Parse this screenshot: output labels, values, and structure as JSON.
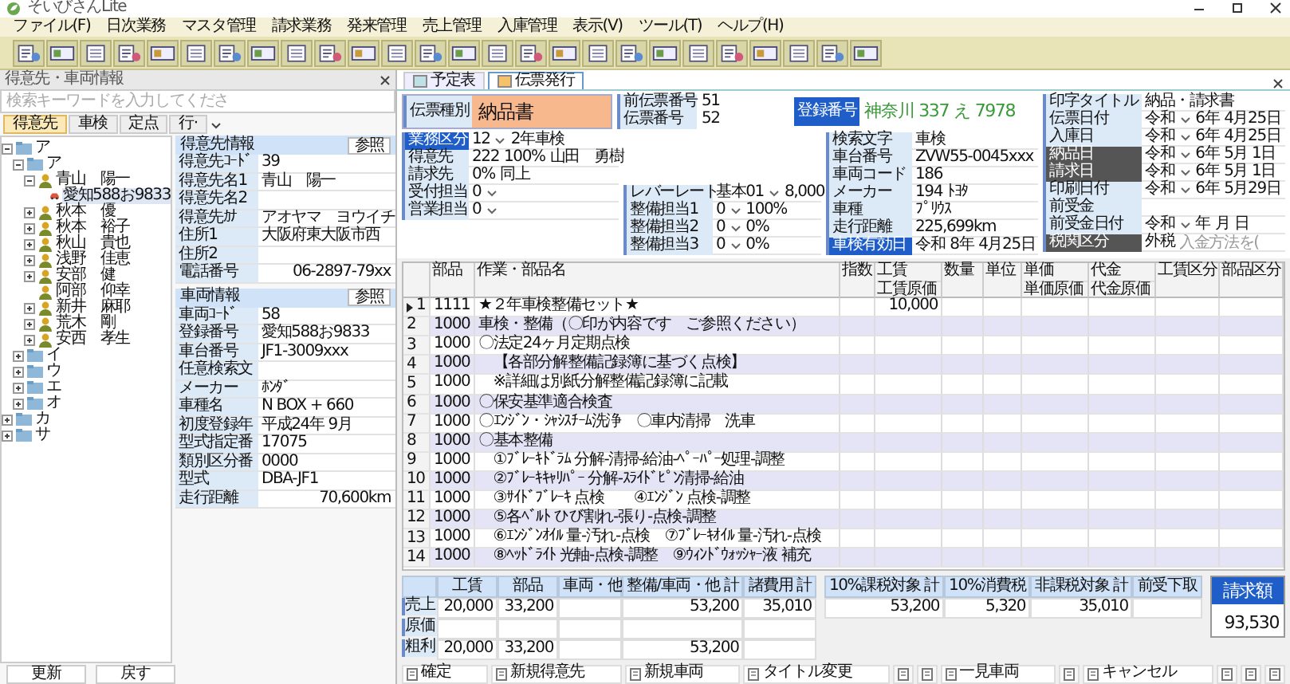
{
  "window": {
    "title": "そいびさんLite"
  },
  "menu": [
    "ファイル(F)",
    "日次業務",
    "マスタ管理",
    "請求業務",
    "発来管理",
    "売上管理",
    "入庫管理",
    "表示(V)",
    "ツール(T)",
    "ヘルプ(H)"
  ],
  "sidebar": {
    "title": "得意先・車両情報",
    "search": {
      "placeholder": "検索キーワードを入力してくださ"
    },
    "tabs": [
      {
        "label": "得意先",
        "selected": true
      },
      {
        "label": "車検",
        "selected": false
      },
      {
        "label": "定点",
        "selected": false
      },
      {
        "label": "行·",
        "selected": false
      }
    ],
    "tree": [
      {
        "label": "ア",
        "kind": "folder",
        "expanded": true,
        "selected": false,
        "children": [
          {
            "label": "ア",
            "kind": "folder",
            "expanded": true,
            "selected": false,
            "children": [
              {
                "label": "青山　陽一",
                "kind": "person",
                "expanded": true,
                "selected": false,
                "children": [
                  {
                    "label": "愛知588お9833",
                    "kind": "car",
                    "selected": true
                  }
                ]
              },
              {
                "label": "秋本　優",
                "kind": "person",
                "expanded": false,
                "selected": false
              },
              {
                "label": "秋本　裕子",
                "kind": "person",
                "expanded": false,
                "selected": false
              },
              {
                "label": "秋山　貴也",
                "kind": "person",
                "expanded": false,
                "selected": false
              },
              {
                "label": "浅野　佳恵",
                "kind": "person",
                "expanded": false,
                "selected": false
              },
              {
                "label": "安部　健",
                "kind": "person",
                "expanded": false,
                "selected": false
              },
              {
                "label": "阿部　仰幸",
                "kind": "person",
                "selected": false
              },
              {
                "label": "新井　麻耶",
                "kind": "person",
                "expanded": false,
                "selected": false
              },
              {
                "label": "荒木　剛",
                "kind": "person",
                "expanded": false,
                "selected": false
              },
              {
                "label": "安西　孝生",
                "kind": "person",
                "expanded": false,
                "selected": false
              }
            ]
          },
          {
            "label": "イ",
            "kind": "folder",
            "expanded": false,
            "selected": false
          },
          {
            "label": "ウ",
            "kind": "folder",
            "expanded": false,
            "selected": false
          },
          {
            "label": "エ",
            "kind": "folder",
            "expanded": false,
            "selected": false
          },
          {
            "label": "オ",
            "kind": "folder",
            "expanded": false,
            "selected": false
          }
        ]
      },
      {
        "label": "カ",
        "kind": "folder",
        "expanded": false,
        "selected": false
      },
      {
        "label": "サ",
        "kind": "folder",
        "expanded": false,
        "selected": false
      }
    ],
    "customer": {
      "title": "得意先情報",
      "button": "参照",
      "fields": [
        {
          "label": "得意先ｺｰﾄﾞ",
          "value": "39"
        },
        {
          "label": "得意先名1",
          "value": "青山　陽一"
        },
        {
          "label": "得意先名2"
        },
        {
          "label": "得意先ｶﾅ",
          "value": "アオヤマ　ヨウイチ"
        },
        {
          "label": "住所1",
          "value": "大阪府東大阪市西"
        },
        {
          "label": "住所2"
        },
        {
          "label": "電話番号",
          "value": "06-2897-79xx"
        }
      ]
    },
    "vehicle": {
      "title": "車両情報",
      "button": "参照",
      "fields": [
        {
          "label": "車両ｺｰﾄﾞ",
          "value": "58"
        },
        {
          "label": "登録番号",
          "value": "愛知588お9833"
        },
        {
          "label": "車台番号",
          "value": "JF1-3009xxx"
        },
        {
          "label": "任意検索文"
        },
        {
          "label": "メーカー",
          "value": "ﾎﾝﾀﾞ"
        },
        {
          "label": "車種名",
          "value": "N BOX + 660"
        },
        {
          "label": "初度登録年",
          "value": "平成24年 9月"
        },
        {
          "label": "型式指定番",
          "value": "17075"
        },
        {
          "label": "類別区分番",
          "value": "0000"
        },
        {
          "label": "型式",
          "value": "DBA-JF1"
        },
        {
          "label": "走行距離",
          "value": "70,600km"
        }
      ]
    },
    "buttons": [
      "更新",
      "戻す"
    ]
  },
  "doc_tabs": [
    {
      "label": "予定表",
      "selected": false
    },
    {
      "label": "伝票発行",
      "selected": true
    }
  ],
  "slip": {
    "type_label": "伝票種別",
    "type": "納品書",
    "prev_no_label": "前伝票番号",
    "prev_no": "51",
    "no_label": "伝票番号",
    "no": "52",
    "plate_label": "登録番号",
    "plate": [
      "神奈川",
      "337",
      "え",
      "7978"
    ]
  },
  "fields_left": [
    {
      "label": "業務区分",
      "values": [
        "12",
        "2年車検"
      ],
      "kind": "accent",
      "dropdown": true
    },
    {
      "label": "得意先",
      "values": [
        "222",
        "100%",
        "山田　勇樹"
      ]
    },
    {
      "label": "請求先",
      "values": [
        "0%",
        "同上"
      ]
    },
    {
      "label": "受付担当",
      "values": [
        "0"
      ],
      "dropdown": true
    },
    {
      "label": "営業担当",
      "values": [
        "0"
      ],
      "dropdown": true
    }
  ],
  "fields_mid": [
    {
      "label": "レバーレート",
      "values": [
        "基本01",
        "8,000"
      ],
      "dropdown": true
    },
    {
      "label": "整備担当1",
      "values": [
        "0",
        "100%"
      ],
      "dropdown": true
    },
    {
      "label": "整備担当2",
      "values": [
        "0",
        "0%"
      ],
      "dropdown": true
    },
    {
      "label": "整備担当3",
      "values": [
        "0",
        "0%"
      ],
      "dropdown": true
    }
  ],
  "fields_vehicle": [
    {
      "label": "検索文字",
      "values": [
        "車検"
      ]
    },
    {
      "label": "車台番号",
      "values": [
        "ZVW55-0045xxx"
      ]
    },
    {
      "label": "車両コード",
      "values": [
        "186"
      ]
    },
    {
      "label": "メーカー",
      "values": [
        "194",
        "ﾄﾖﾀ"
      ]
    },
    {
      "label": "車種",
      "values": [
        "ﾌﾟﾘｳｽ"
      ]
    },
    {
      "label": "走行距離",
      "values": [
        "225,699km"
      ]
    },
    {
      "label": "車検有効日",
      "values": [
        "令和",
        "8年",
        "4月25日"
      ],
      "kind": "accent"
    }
  ],
  "fields_dates": [
    {
      "label": "印字タイトル",
      "values": [
        "納品・請求書"
      ]
    },
    {
      "label": "伝票日付",
      "values": [
        "令和",
        "6年",
        "4月25日"
      ],
      "dropdown": true
    },
    {
      "label": "入庫日",
      "values": [
        "令和",
        "6年",
        "4月25日"
      ],
      "dropdown": true
    },
    {
      "label": "納品日",
      "values": [
        "令和",
        "6年",
        "5月 1日"
      ],
      "kind": "dark",
      "dropdown": true
    },
    {
      "label": "請求日",
      "values": [
        "令和",
        "6年",
        "5月 1日"
      ],
      "kind": "dark",
      "dropdown": true
    },
    {
      "label": "印刷日付",
      "values": [
        "令和",
        "6年",
        "5月29日"
      ],
      "dropdown": true
    },
    {
      "label": "前受金"
    },
    {
      "label": "前受金日付",
      "values": [
        "令和",
        "年",
        "月",
        "日"
      ],
      "dropdown": true
    },
    {
      "label": "税関区分",
      "values": [
        "外税"
      ],
      "kind": "dark",
      "placeholder": "入金方法を("
    }
  ],
  "table": {
    "columns": [
      {
        "label": "部品"
      },
      {
        "label": "作業・部品名"
      },
      {
        "label": "指数"
      },
      {
        "label": "工賃",
        "sublabel": "工賃原価"
      },
      {
        "label": "数量"
      },
      {
        "label": "単位"
      },
      {
        "label": "単価",
        "sublabel": "単価原価"
      },
      {
        "label": "代金",
        "sublabel": "代金原価"
      },
      {
        "label": "工賃区分"
      },
      {
        "label": "部品区分"
      }
    ],
    "rows": [
      {
        "no": "1",
        "part": "1111",
        "name": "★２年車検整備セット★",
        "wage": "10,000",
        "current": true
      },
      {
        "no": "2",
        "part": "1000",
        "name": "車検・整備（〇印が内容です　ご参照ください）",
        "current": false
      },
      {
        "no": "3",
        "part": "1000",
        "name": "〇法定24ヶ月定期点検",
        "current": false
      },
      {
        "no": "4",
        "part": "1000",
        "name": "　【各部分解整備記録簿に基づく点検】",
        "current": false
      },
      {
        "no": "5",
        "part": "1000",
        "name": "　※詳細は別紙分解整備記録簿に記載",
        "current": false
      },
      {
        "no": "6",
        "part": "1000",
        "name": "〇保安基準適合検査",
        "current": false
      },
      {
        "no": "7",
        "part": "1000",
        "name": "〇ｴﾝｼﾞﾝ・ｼｬｼｽﾁｰﾑ洗浄　〇車内清掃　洗車",
        "current": false
      },
      {
        "no": "8",
        "part": "1000",
        "name": "〇基本整備",
        "current": false
      },
      {
        "no": "9",
        "part": "1000",
        "name": "　①ﾌﾞﾚｰｷﾄﾞﾗﾑ 分解-清掃-給油-ﾍﾟｰﾊﾟｰ処理-調整",
        "current": false
      },
      {
        "no": "10",
        "part": "1000",
        "name": "　②ﾌﾞﾚｰｷｷｬﾘﾊﾟｰ 分解-ｽﾗｲﾄﾞﾋﾟﾝ清掃-給油",
        "current": false
      },
      {
        "no": "11",
        "part": "1000",
        "name": "　③ｻｲﾄﾞﾌﾞﾚｰｷ 点検　　④ｴﾝｼﾞﾝ 点検-調整",
        "current": false
      },
      {
        "no": "12",
        "part": "1000",
        "name": "　⑤各ﾍﾞﾙﾄ ひび割れ-張り-点検-調整",
        "current": false
      },
      {
        "no": "13",
        "part": "1000",
        "name": "　⑥ｴﾝｼﾞﾝｵｲﾙ 量-汚れ-点検　⑦ﾌﾞﾚｰｷｵｲﾙ 量-汚れ-点検",
        "current": false
      },
      {
        "no": "14",
        "part": "1000",
        "name": "　⑧ﾍｯﾄﾞﾗｲﾄ 光軸-点検-調整　⑨ｳｨﾝﾄﾞｳｫｯｼｬｰ液 補充",
        "current": false
      }
    ]
  },
  "summary": {
    "columns": [
      "工賃",
      "部品",
      "車両・他",
      "整備/車両・他 計",
      "諸費用 計"
    ],
    "rows": [
      {
        "label": "売上",
        "wage": "20,000",
        "parts": "33,200",
        "maintenance_total": "53,200",
        "expenses_total": "35,010"
      },
      {
        "label": "原価"
      },
      {
        "label": "粗利",
        "wage": "20,000",
        "parts": "33,200",
        "maintenance_total": "53,200"
      }
    ]
  },
  "tax": {
    "columns": [
      "10%課税対象 計",
      "10%消費税",
      "非課税対象 計",
      "前受下取"
    ],
    "taxable_10": "53,200",
    "tax_10": "5,320",
    "non_taxable": "35,010"
  },
  "total": {
    "label": "請求額",
    "value": "93,530"
  },
  "function_keys": [
    {
      "label": "確定"
    },
    {
      "label": "新規得意先"
    },
    {
      "label": "新規車両"
    },
    {
      "label": "タイトル変更"
    },
    {
      "kind": "blank"
    },
    {
      "kind": "blank"
    },
    {
      "label": "一見車両"
    },
    {
      "kind": "blank"
    },
    {
      "label": "キャンセル"
    },
    {
      "kind": "blank"
    },
    {
      "kind": "blank"
    },
    {
      "kind": "blank"
    }
  ]
}
